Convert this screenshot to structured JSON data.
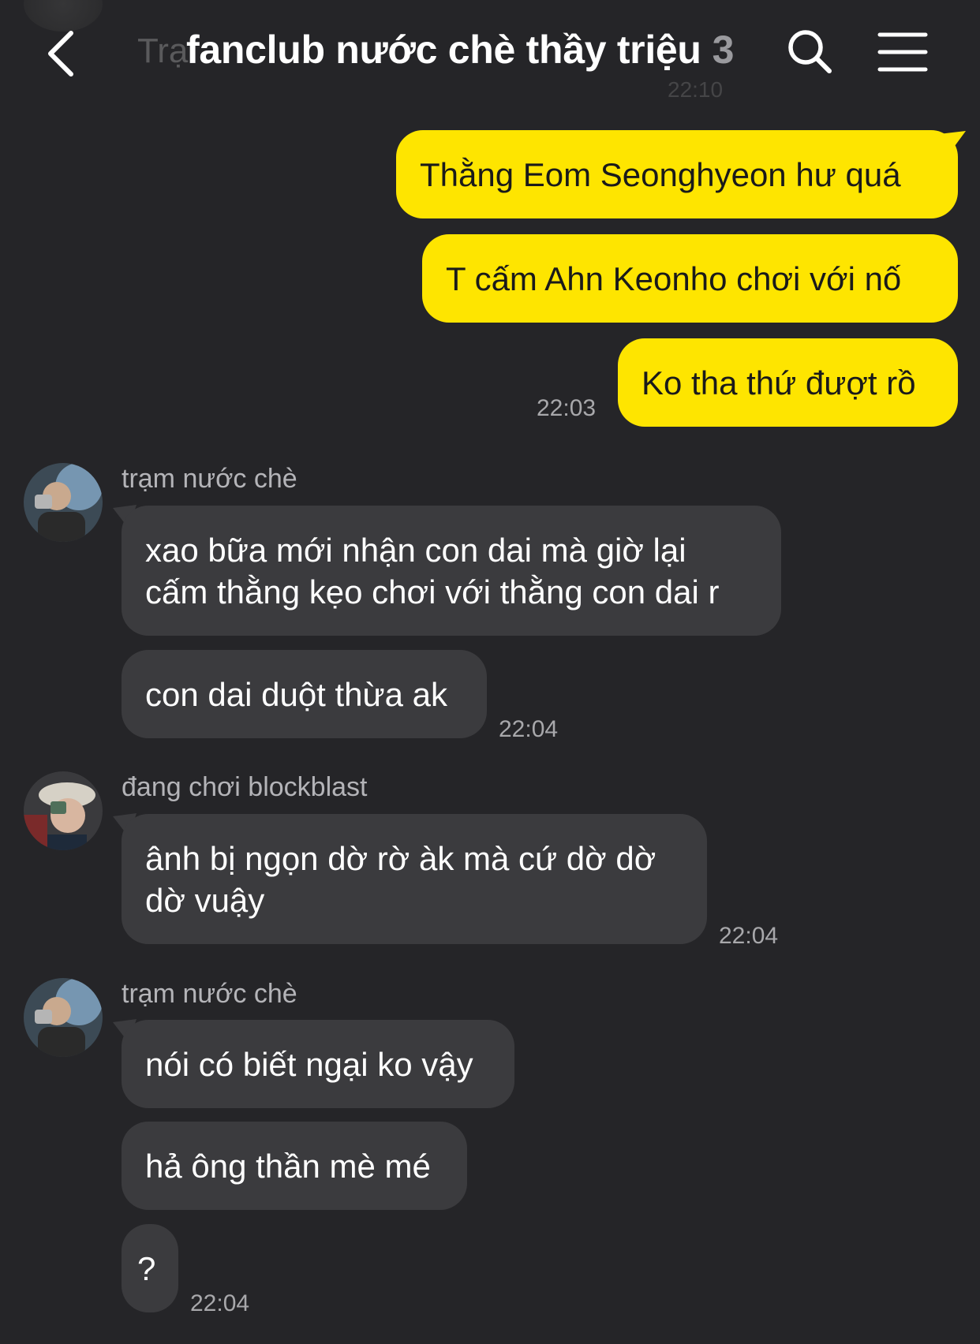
{
  "header": {
    "title": "fanclub nước chè thầy triệu",
    "member_count": "3",
    "ghost_preview": "Trạ",
    "ghost_time": "22:10"
  },
  "messages_mine": [
    {
      "text": "Thằng Eom Seonghyeon hư quá"
    },
    {
      "text": "T cấm Ahn Keonho chơi với nố"
    },
    {
      "text": "Ko tha thứ đượt rồ"
    }
  ],
  "mine_time": "22:03",
  "groups": [
    {
      "sender": "trạm nước chè",
      "messages": [
        {
          "lines": [
            "xao bữa mới nhận con dai mà giờ lại",
            "cấm thằng kẹo chơi với thằng con dai r"
          ]
        },
        {
          "lines": [
            "con dai duột thừa ak"
          ]
        }
      ],
      "time": "22:04"
    },
    {
      "sender": "đang chơi blockblast",
      "messages": [
        {
          "lines": [
            "ânh bị ngọn dờ rờ àk mà cứ dờ dờ",
            "dờ vuậy"
          ]
        }
      ],
      "time": "22:04"
    },
    {
      "sender": "trạm nước chè",
      "messages": [
        {
          "lines": [
            "nói có biết ngại ko vậy"
          ]
        },
        {
          "lines": [
            "hả ông thần mè mé"
          ]
        },
        {
          "lines": [
            "?"
          ]
        }
      ],
      "time": "22:04"
    }
  ],
  "colors": {
    "background": "#252528",
    "my_bubble": "#fee500",
    "their_bubble": "#3b3b3e"
  }
}
